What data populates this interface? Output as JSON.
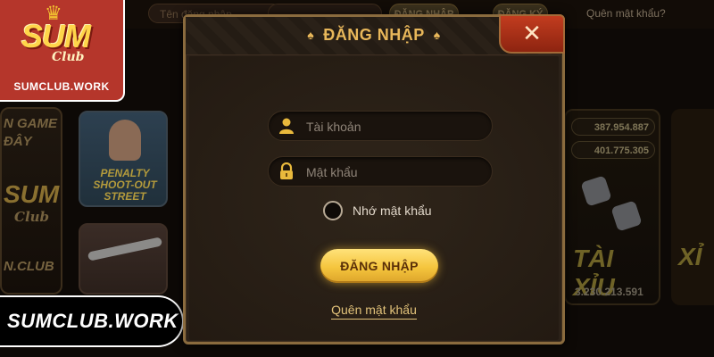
{
  "background": {
    "topbar": {
      "username_placeholder": "Tên đăng nhập",
      "login_button": "ĐĂNG NHẬP",
      "register_button": "ĐĂNG KÝ",
      "forgot_password": "Quên mật khẩu?"
    },
    "left_card_lines": [
      "N GAME",
      "ĐÂY",
      "SUM",
      "Club",
      "N.CLUB"
    ],
    "penalty_card_text": "PENALTY SHOOT-OUT STREET",
    "taixiu": {
      "balance_top": "387.954.887",
      "balance_mid": "401.775.305",
      "label": "TÀI XỈU",
      "total": "3.230.213.591"
    },
    "right_card_label": "XỈ"
  },
  "logo": {
    "brand": "SUM",
    "sub": "Club",
    "site": "SUMCLUB.WORK"
  },
  "site_banner": "SUMCLUB.WORK",
  "modal": {
    "title": "ĐĂNG NHẬP",
    "close_symbol": "✕",
    "username": {
      "value": "",
      "placeholder": "Tài khoản",
      "icon": "user-icon"
    },
    "password": {
      "value": "",
      "placeholder": "Mật khẩu",
      "icon": "lock-icon"
    },
    "remember_label": "Nhớ mật khẩu",
    "remember_checked": false,
    "login_button": "ĐĂNG NHẬP",
    "forgot_link": "Quên mật khẩu"
  },
  "colors": {
    "accent_gold": "#e8b75a",
    "button_gold": "#f5c53d",
    "close_red": "#c23c1f",
    "modal_bg": "#2b2118"
  }
}
